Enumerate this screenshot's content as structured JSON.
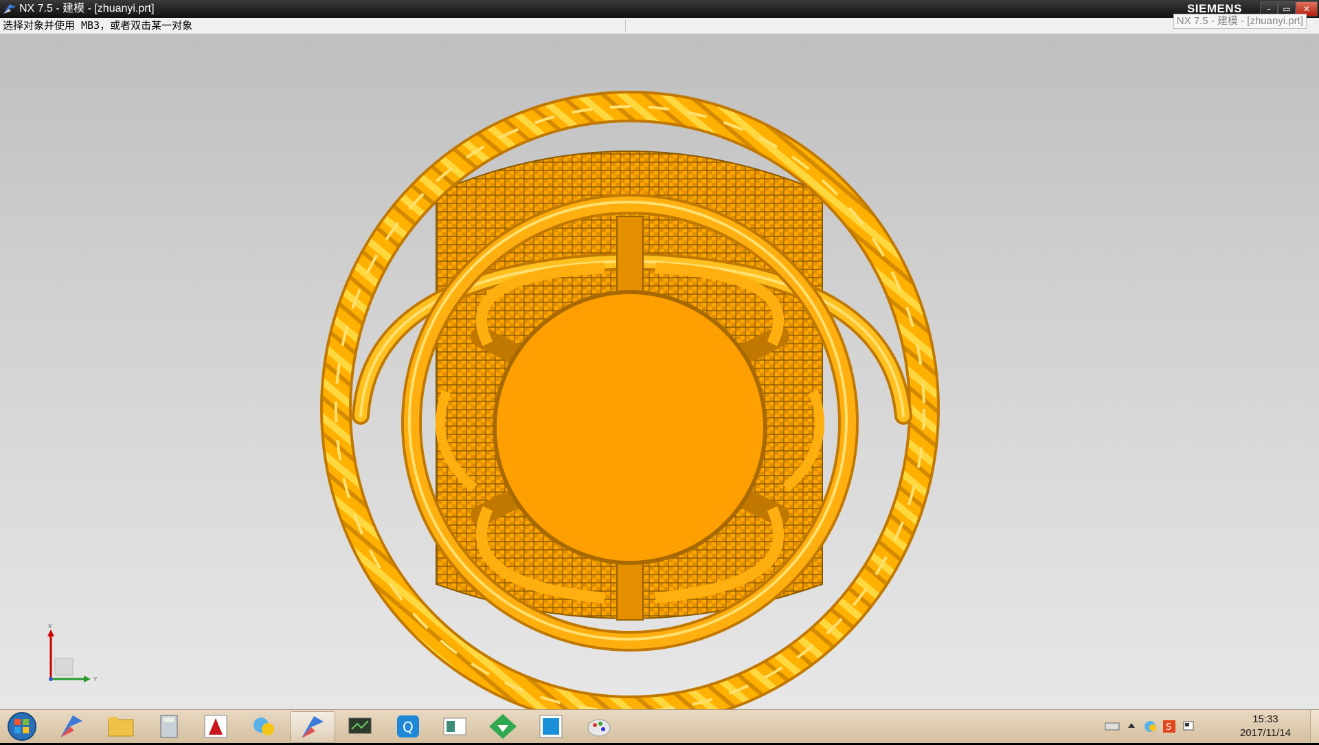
{
  "window": {
    "title": "NX 7.5 - 建模 - [zhuanyi.prt]",
    "brand": "SIEMENS",
    "controls": {
      "minimize": "–",
      "maximize": "▭",
      "close": "✕"
    }
  },
  "cue_line": {
    "prompt": "选择对象并使用 MB3，或者双击某一对象",
    "ghost_title": "NX 7.5 - 建模 - [zhuanyi.prt]"
  },
  "triad": {
    "x_label": "X",
    "y_label": "Y"
  },
  "colors": {
    "model_gold": "#FFA500",
    "model_highlight": "#FFD23A",
    "model_shadow": "#C87800",
    "viewport_top": "#BFBFBF",
    "viewport_bottom": "#E7E7E7",
    "taskbar": "#E0CFB4"
  },
  "taskbar": {
    "start": "start-orb-icon",
    "items": [
      {
        "name": "nx-app-icon",
        "active": false
      },
      {
        "name": "folder-icon",
        "active": false
      },
      {
        "name": "calculator-icon",
        "active": false
      },
      {
        "name": "autocad-icon",
        "active": false
      },
      {
        "name": "chat-icon",
        "active": false
      },
      {
        "name": "nx-app-icon-active",
        "active": true
      },
      {
        "name": "monitor-icon",
        "active": false
      },
      {
        "name": "qq-icon",
        "active": false
      },
      {
        "name": "window-icon",
        "active": false
      },
      {
        "name": "download-icon",
        "active": false
      },
      {
        "name": "blue-square-icon",
        "active": false
      },
      {
        "name": "paint-icon",
        "active": false
      }
    ],
    "tray": [
      "keyboard-icon",
      "tray-expand-icon",
      "network-icon",
      "sogou-input-icon",
      "flag-icon"
    ],
    "clock_time": "15:33",
    "clock_date": "2017/11/14"
  }
}
